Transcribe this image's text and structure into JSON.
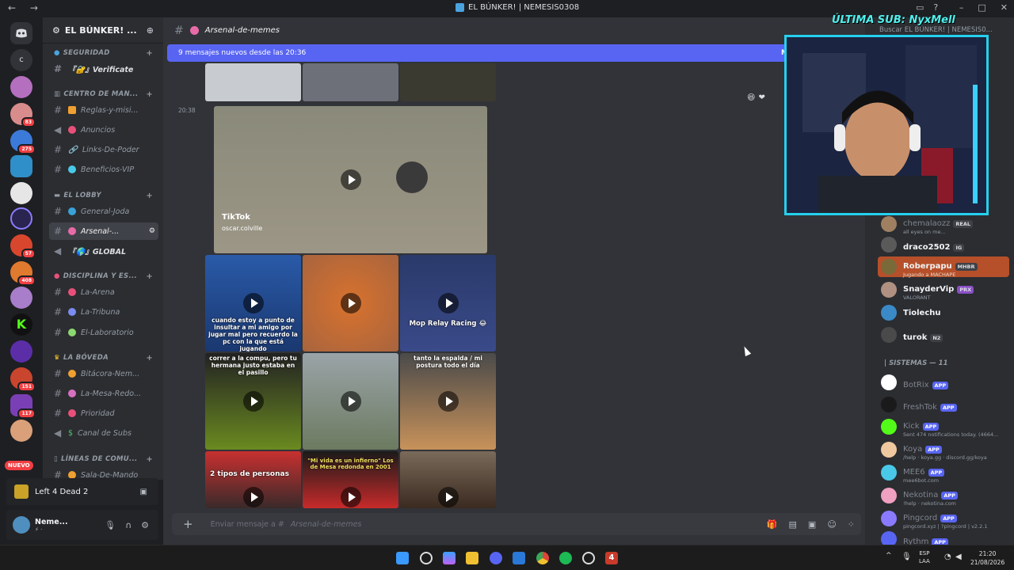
{
  "window": {
    "title": "EL BÚNKER! | NEMESIS0308",
    "back": "←",
    "forward": "→"
  },
  "server_badges": [
    "83",
    "275",
    "57",
    "408",
    "151",
    "117"
  ],
  "server_letter": "c",
  "nuevo": "NUEVO",
  "guild": {
    "name": "EL BÚNKER! ...",
    "chevron": "⌄",
    "add": "⊕"
  },
  "categories": [
    {
      "name": "SEGURIDAD",
      "icon": "shield-icon"
    },
    {
      "name": "CENTRO DE MAN...",
      "icon": "bank-icon"
    },
    {
      "name": "EL LOBBY",
      "icon": "couch-icon"
    },
    {
      "name": "DISCIPLINA Y ES...",
      "icon": "drop-icon"
    },
    {
      "name": "LA BÓVEDA",
      "icon": "crown-icon"
    },
    {
      "name": "LÍNEAS DE COMU...",
      "icon": "phone-icon"
    }
  ],
  "channels": [
    {
      "name": "『🔐』Verificate"
    },
    {
      "name": "Reglas-y-misi..."
    },
    {
      "name": "Anuncios"
    },
    {
      "name": "Links-De-Poder"
    },
    {
      "name": "Beneficios-VIP"
    },
    {
      "name": "General-Joda"
    },
    {
      "name": "Arsenal-..."
    },
    {
      "name": "『🌎』GLOBAL"
    },
    {
      "name": "La-Arena"
    },
    {
      "name": "La-Tribuna"
    },
    {
      "name": "El-Laboratorio"
    },
    {
      "name": "Bitácora-Nem..."
    },
    {
      "name": "La-Mesa-Redo..."
    },
    {
      "name": "Prioridad"
    },
    {
      "name": "Canal de Subs"
    },
    {
      "name": "Sala-De-Mando"
    }
  ],
  "activity": {
    "game": "Left 4 Dead 2"
  },
  "user": {
    "name": "Neme...",
    "status": "⚡ ·"
  },
  "chat": {
    "channel": "Arsenal-de-memes",
    "new_messages": "9 mensajes nuevos desde las 20:36",
    "new_mark": "M",
    "timestamp": "20:38",
    "placeholder": "Enviar mensaje a #",
    "placeholder_channel": "Arsenal-de-memes"
  },
  "videos": [
    {
      "caption": "TikTok",
      "handle": "oscar.colville"
    },
    {
      "caption": "cuando estoy a punto de insultar a mi amigo por jugar mal pero recuerdo la pc con la que está jugando"
    },
    {
      "caption": ""
    },
    {
      "caption": "Mop Relay Racing 😂"
    },
    {
      "caption": "correr a la compu, pero tu hermana justo estaba en el pasillo"
    },
    {
      "caption": ""
    },
    {
      "caption": "tanto la espalda / mi postura todo el día"
    },
    {
      "caption": "2 tipos de personas"
    },
    {
      "caption": "\"Mi vida es un infierno\" Los de Mesa redonda en 2001"
    },
    {
      "caption": ""
    }
  ],
  "members": [
    {
      "name": "chemalaozz",
      "tag": "REAL",
      "sub": "all eyes on me..."
    },
    {
      "name": "draco2502",
      "tag": "IG",
      "sub": ""
    },
    {
      "name": "Roberpapu",
      "tag": "MHBR",
      "sub": "Jugando a MACHAPE"
    },
    {
      "name": "SnayderVip",
      "tag": "PRX",
      "sub": "VALORANT"
    },
    {
      "name": "Tiolechu",
      "tag": "",
      "sub": ""
    },
    {
      "name": "turok",
      "tag": "N2",
      "sub": ""
    }
  ],
  "systems_header": "| SISTEMAS — 11",
  "bots": [
    {
      "name": "BotRix",
      "tag": "APP",
      "sub": ""
    },
    {
      "name": "FreshTok",
      "tag": "APP",
      "sub": ""
    },
    {
      "name": "Kick",
      "tag": "APP",
      "sub": "Sent 474 notifications today. (4664..."
    },
    {
      "name": "Koya",
      "tag": "APP",
      "sub": "/help · koya.gg · discord.gg/koya"
    },
    {
      "name": "MEE6",
      "tag": "APP",
      "sub": "mee6bot.com"
    },
    {
      "name": "Nekotina",
      "tag": "APP",
      "sub": "!help · nekotina.com"
    },
    {
      "name": "Pingcord",
      "tag": "APP",
      "sub": "pingcord.xyz | ?pingcord | v2.2.1"
    },
    {
      "name": "Rythm",
      "tag": "APP",
      "sub": ""
    }
  ],
  "overlay": {
    "sub_title": "ÚLTIMA SUB: NyxMell",
    "search": "Buscar EL BÚNKER! | NEMESIS0..."
  },
  "taskbar": {
    "lang": "ESP",
    "layout": "LAA",
    "time": "21:20",
    "date": "21/08/2026",
    "chevron": "^",
    "spotify_badge": "4"
  },
  "colors": {
    "accent": "#5865f2",
    "cam_border": "#25d0ee",
    "danger": "#f23f43"
  }
}
